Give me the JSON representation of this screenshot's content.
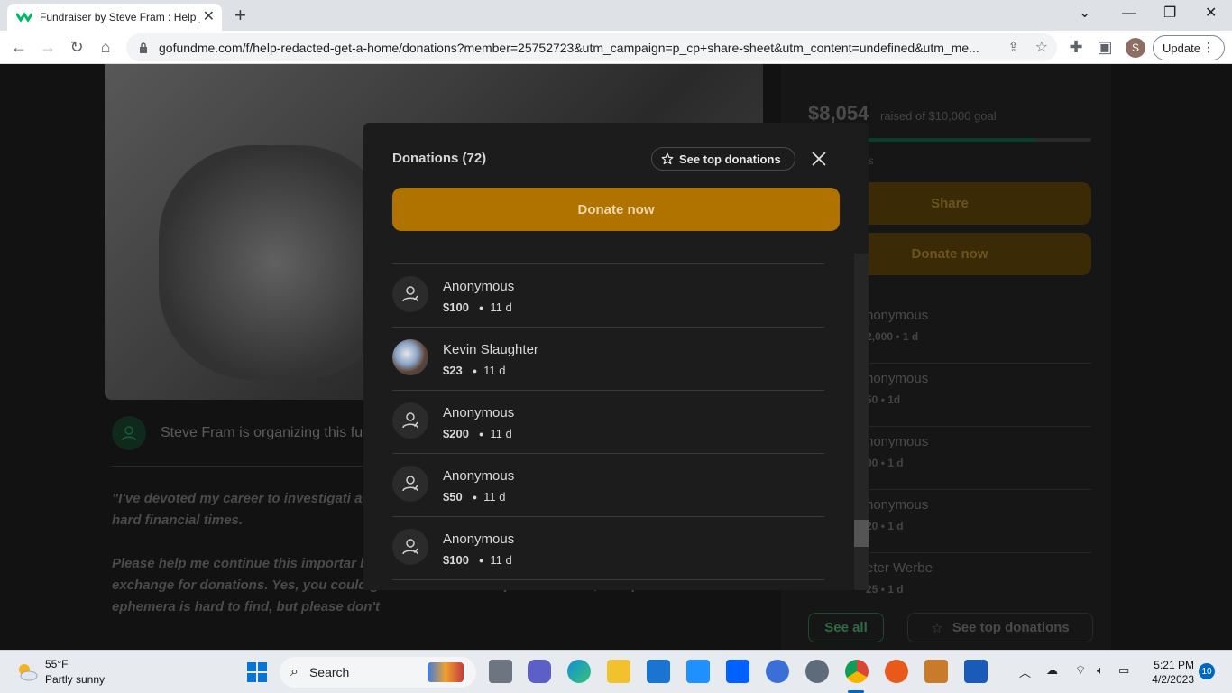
{
  "browser": {
    "tab_title": "Fundraiser by Steve Fram : Help _",
    "url": "gofundme.com/f/help-redacted-get-a-home/donations?member=25752723&utm_campaign=p_cp+share-sheet&utm_content=undefined&utm_me...",
    "profile_initial": "S",
    "update_label": "Update"
  },
  "background": {
    "organizer_text": "Steve Fram is organizing this fur",
    "story_p1": "\"I've devoted my career to investigati anarchism and surrealism, those that a find myself in hard financial times.",
    "story_p2": "Please help me continue this importar books and ephemera that I've discovered, in exchange for donations. Yes, you could get these much cheaper elsewhere, except the ephemera is hard to find, but please don't",
    "raised_amount": "$8,054",
    "raised_goal": "raised of $10,000 goal",
    "progress": 0.805,
    "donations_fragment": "ns",
    "share_label": "Share",
    "donate_label": "Donate now",
    "side_list": [
      {
        "name": "nonymous",
        "amount": "2,000",
        "time": "1 d"
      },
      {
        "name": "nonymous",
        "amount": "50",
        "time": "1d"
      },
      {
        "name": "nonymous",
        "amount": "00",
        "time": "1 d"
      },
      {
        "name": "nonymous",
        "amount": "20",
        "time": "1 d"
      },
      {
        "name": "eter Werbe",
        "amount": "25",
        "time": "1 d"
      }
    ],
    "see_all_label": "See all",
    "see_top_label": "See top donations"
  },
  "modal": {
    "title": "Donations (72)",
    "see_top_label": "See top donations",
    "donate_label": "Donate now",
    "donations": [
      {
        "name": "Anonymous",
        "amount": "$100",
        "time": "11 d"
      },
      {
        "name": "Kevin Slaughter",
        "amount": "$23",
        "time": "11 d"
      },
      {
        "name": "Anonymous",
        "amount": "$200",
        "time": "11 d"
      },
      {
        "name": "Anonymous",
        "amount": "$50",
        "time": "11 d"
      },
      {
        "name": "Anonymous",
        "amount": "$100",
        "time": "11 d"
      }
    ],
    "dot": "●"
  },
  "taskbar": {
    "weather_temp": "55°F",
    "weather_desc": "Partly sunny",
    "search_label": "Search",
    "time": "5:21 PM",
    "date": "4/2/2023",
    "notifications": "10"
  },
  "colors": {
    "donate": "#b07300",
    "modal_bg": "#1c1c1c",
    "gofundme_green": "#00b964"
  }
}
